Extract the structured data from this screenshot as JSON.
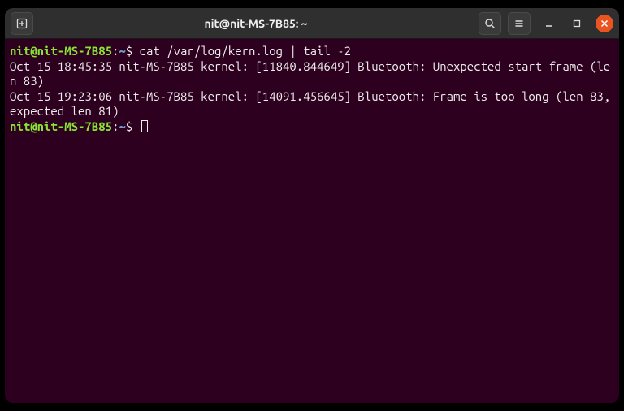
{
  "titlebar": {
    "title": "nit@nit-MS-7B85: ~"
  },
  "prompt": {
    "user_host": "nit@nit-MS-7B85",
    "sep": ":",
    "path": "~",
    "symbol": "$ "
  },
  "lines": {
    "cmd1": "cat /var/log/kern.log | tail -2",
    "out1": "Oct 15 18:45:35 nit-MS-7B85 kernel: [11840.844649] Bluetooth: Unexpected start frame (len 83)",
    "out2": "Oct 15 19:23:06 nit-MS-7B85 kernel: [14091.456645] Bluetooth: Frame is too long (len 83, expected len 81)"
  }
}
